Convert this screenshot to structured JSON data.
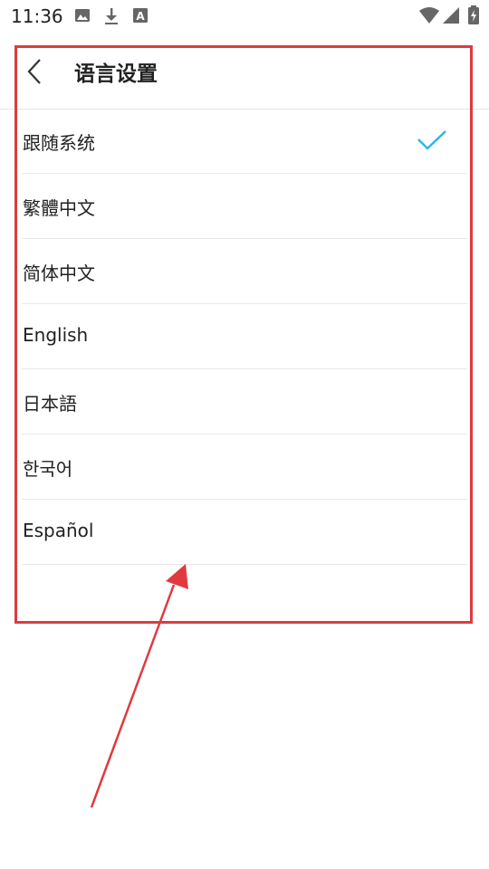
{
  "status_bar": {
    "time": "11:36",
    "icons": [
      "image-icon",
      "download-icon",
      "font-a-icon",
      "wifi-icon",
      "signal-icon",
      "battery-charging-icon"
    ]
  },
  "header": {
    "title": "语言设置",
    "back_icon": "chevron-left-icon"
  },
  "languages": [
    {
      "label": "跟随系统",
      "selected": true
    },
    {
      "label": "繁體中文",
      "selected": false
    },
    {
      "label": "简体中文",
      "selected": false
    },
    {
      "label": "English",
      "selected": false
    },
    {
      "label": "日本語",
      "selected": false
    },
    {
      "label": "한국어",
      "selected": false
    },
    {
      "label": "Español",
      "selected": false
    }
  ],
  "colors": {
    "check": "#29b6e8",
    "annotation": "#e03a3e"
  }
}
